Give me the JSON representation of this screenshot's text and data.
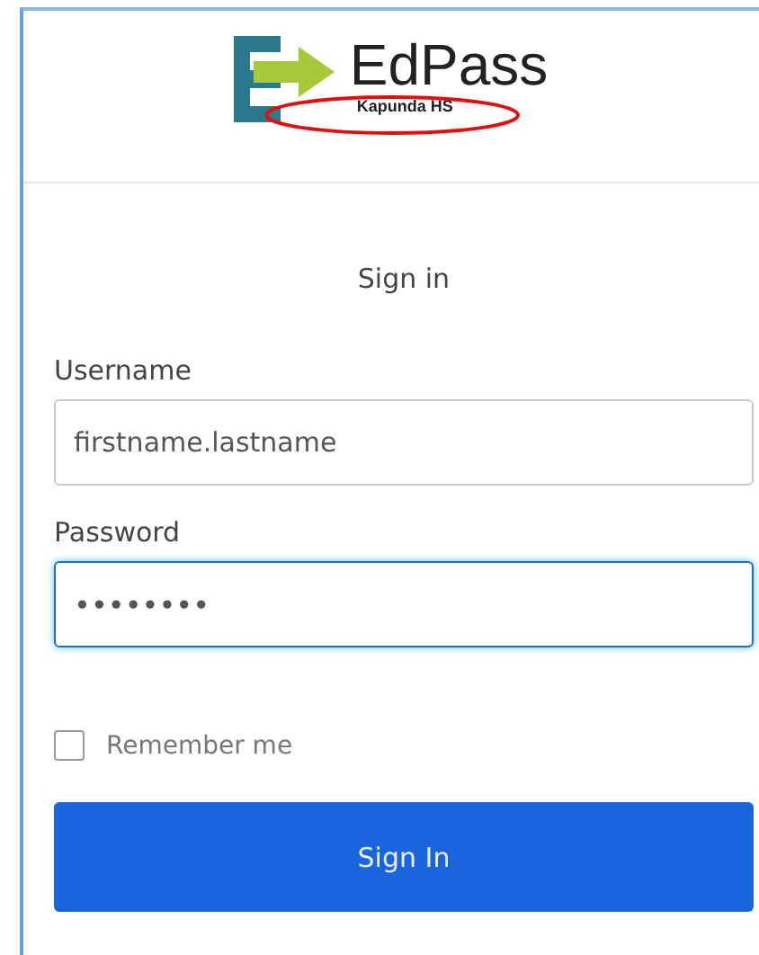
{
  "logo": {
    "name": "EdPass",
    "school": "Kapunda HS",
    "school_circled": true
  },
  "heading": "Sign in",
  "fields": [
    {
      "label": "Username",
      "value": "firstname.lastname",
      "focused": false
    },
    {
      "label": "Password",
      "value": "••••••••",
      "focused": true
    }
  ],
  "remember": {
    "label": "Remember me",
    "checked": false
  },
  "button": "Sign In"
}
